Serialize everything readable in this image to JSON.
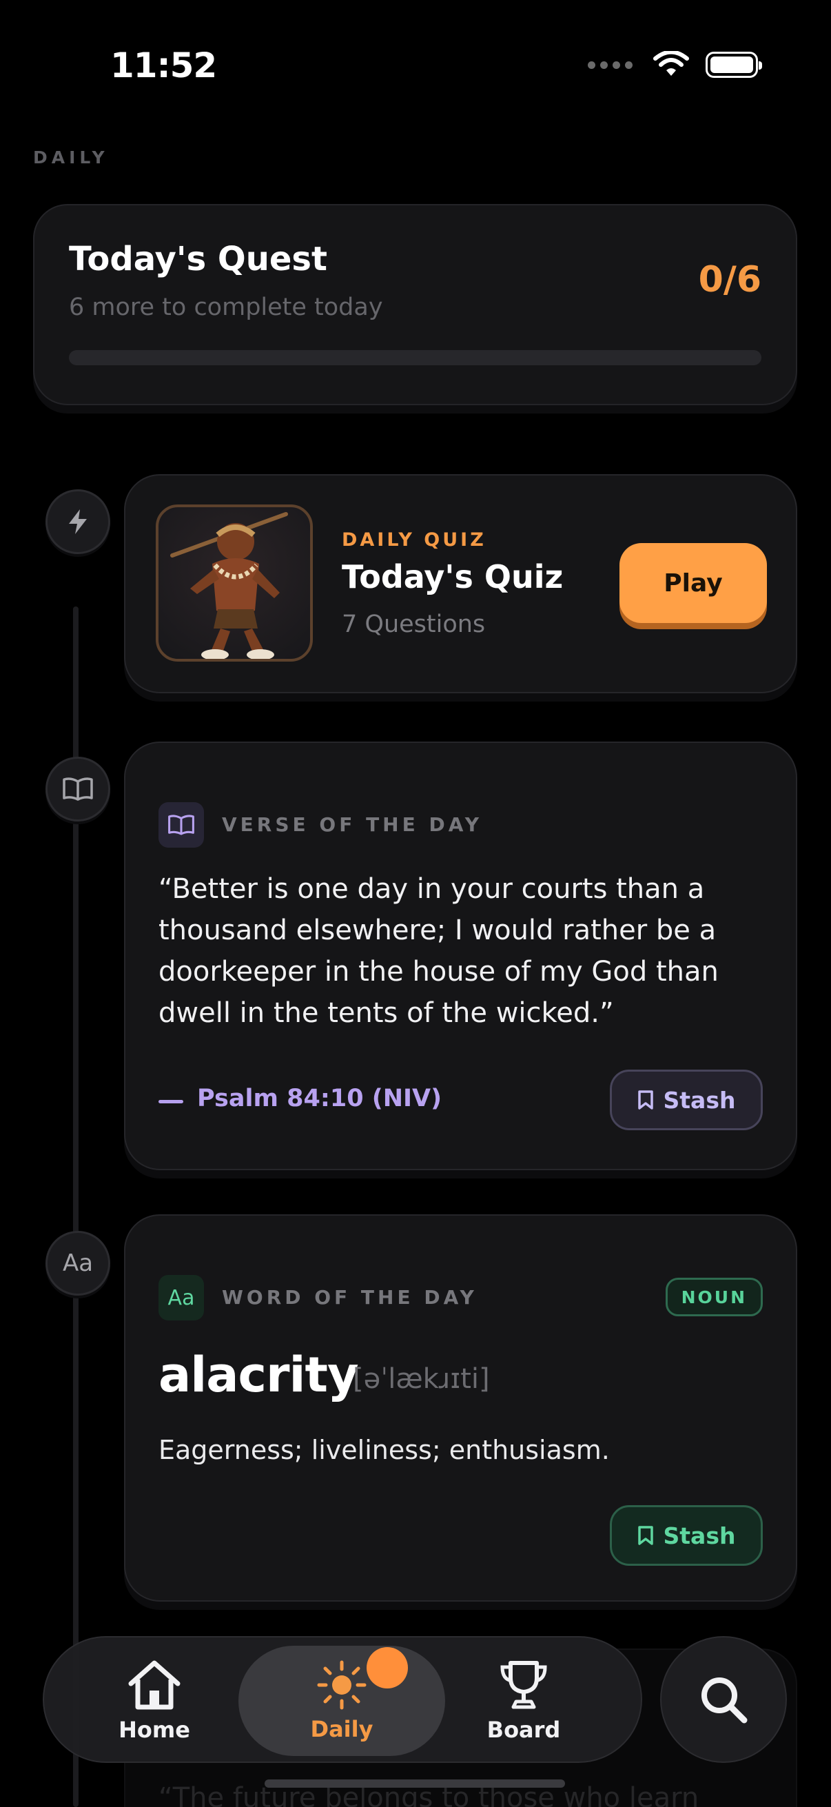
{
  "status": {
    "time": "11:52"
  },
  "section_label": "DAILY",
  "quest": {
    "title": "Today's Quest",
    "subtitle": "6 more to complete today",
    "count": "0/6",
    "progress": 0
  },
  "quiz": {
    "tag": "DAILY QUIZ",
    "title": "Today's Quiz",
    "subtitle": "7 Questions",
    "play_label": "Play"
  },
  "verse": {
    "tag": "VERSE OF THE DAY",
    "text": "“Better is one day in your courts than a thousand elsewhere; I would rather be a doorkeeper in the house of my God than dwell in the tents of the wicked.”",
    "reference": "Psalm 84:10 (NIV)",
    "stash_label": "Stash"
  },
  "word": {
    "icon_text": "Aa",
    "tag": "WORD OF THE DAY",
    "badge": "NOUN",
    "word": "alacrity",
    "phonetic": "[əˈlækɹɪti]",
    "definition": "Eagerness; liveliness; enthusiasm.",
    "stash_label": "Stash"
  },
  "peek": {
    "text": "“The future belongs to those who learn"
  },
  "tabs": {
    "home": "Home",
    "daily": "Daily",
    "board": "Board"
  },
  "colors": {
    "accent": "#f59a45",
    "verse": "#b8a2f0",
    "word": "#5fd7a0"
  }
}
